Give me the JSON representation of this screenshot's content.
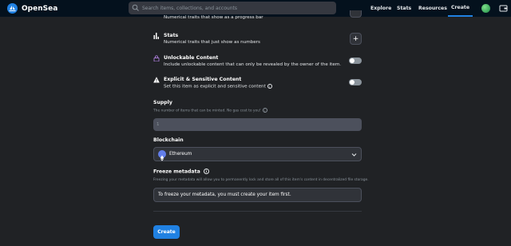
{
  "header": {
    "logo_text": "OpenSea",
    "search_placeholder": "Search items, collections, and accounts",
    "nav": [
      "Explore",
      "Stats",
      "Resources",
      "Create"
    ],
    "active_nav": "Create"
  },
  "traits": {
    "levels_desc": "Numerical traits that show as a progress bar",
    "stats_title": "Stats",
    "stats_desc": "Numerical traits that just show as numbers",
    "unlockable_title": "Unlockable Content",
    "unlockable_desc": "Include unlockable content that can only be revealed by the owner of the item.",
    "explicit_title": "Explicit & Sensitive Content",
    "explicit_desc": "Set this item as explicit and sensitive content"
  },
  "supply": {
    "title": "Supply",
    "note": "The number of items that can be minted. No gas cost to you!",
    "value": "1"
  },
  "blockchain": {
    "title": "Blockchain",
    "selected": "Ethereum"
  },
  "freeze": {
    "title": "Freeze metadata",
    "note": "Freezing your metadata will allow you to permanently lock and store all of this item's content in decentralized file storage.",
    "box_text": "To freeze your metadata, you must create your item first."
  },
  "create_label": "Create",
  "colors": {
    "accent": "#2081e2",
    "background": "#202225",
    "header": "#04111d"
  }
}
